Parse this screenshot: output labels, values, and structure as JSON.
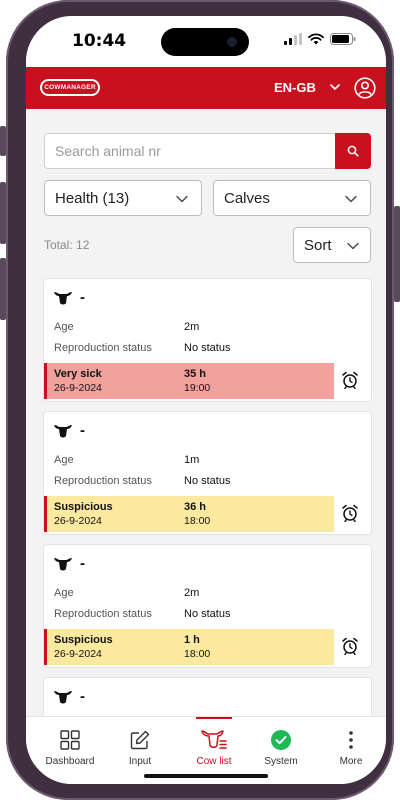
{
  "status_bar": {
    "time": "10:44"
  },
  "header": {
    "logo_text": "COWMANAGER",
    "language": "EN-GB"
  },
  "search": {
    "placeholder": "Search animal nr"
  },
  "filters": {
    "health": "Health (13)",
    "group": "Calves"
  },
  "list": {
    "total": "Total: 12",
    "sort_label": "Sort"
  },
  "cards": [
    {
      "title": "-",
      "age_label": "Age",
      "age": "2m",
      "repro_label": "Reproduction status",
      "repro": "No status",
      "alert": {
        "status": "Very sick",
        "date": "26-9-2024",
        "hours": "35 h",
        "time": "19:00",
        "level": "red"
      }
    },
    {
      "title": "-",
      "age_label": "Age",
      "age": "1m",
      "repro_label": "Reproduction status",
      "repro": "No status",
      "alert": {
        "status": "Suspicious",
        "date": "26-9-2024",
        "hours": "36 h",
        "time": "18:00",
        "level": "yellow"
      }
    },
    {
      "title": "-",
      "age_label": "Age",
      "age": "2m",
      "repro_label": "Reproduction status",
      "repro": "No status",
      "alert": {
        "status": "Suspicious",
        "date": "26-9-2024",
        "hours": "1 h",
        "time": "18:00",
        "level": "yellow"
      }
    },
    {
      "title": "-"
    }
  ],
  "nav": {
    "dashboard": "Dashboard",
    "input": "Input",
    "cowlist": "Cow list",
    "system": "System",
    "more": "More"
  },
  "colors": {
    "brand": "#c8101e",
    "very_sick": "#f2a19d",
    "suspicious": "#fbe9a0",
    "system_ok": "#1db954"
  }
}
